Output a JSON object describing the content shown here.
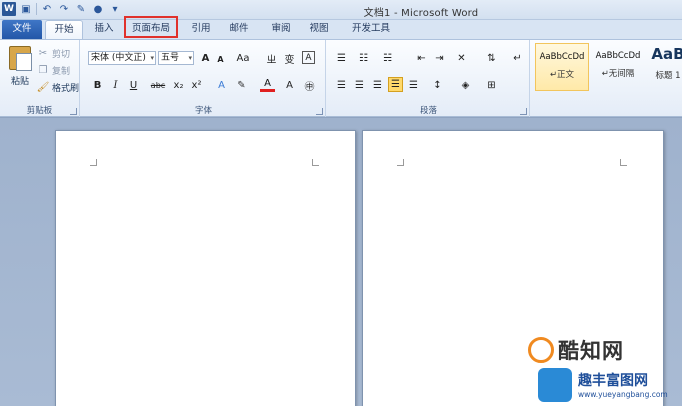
{
  "window": {
    "title": "文档1 - Microsoft Word"
  },
  "qat": {
    "word_logo": "W"
  },
  "tabs": [
    {
      "label": "文件"
    },
    {
      "label": "开始"
    },
    {
      "label": "插入"
    },
    {
      "label": "页面布局"
    },
    {
      "label": "引用"
    },
    {
      "label": "邮件"
    },
    {
      "label": "审阅"
    },
    {
      "label": "视图"
    },
    {
      "label": "开发工具"
    }
  ],
  "clipboard": {
    "paste": "粘贴",
    "cut": "剪切",
    "copy": "复制",
    "format_painter": "格式刷",
    "label": "剪贴板"
  },
  "font": {
    "name": "宋体 (中文正)",
    "size": "五号",
    "grow": "A",
    "shrink": "A",
    "change_case": "Aa",
    "bold": "B",
    "italic": "I",
    "underline": "U",
    "strike": "abc",
    "subscript": "x₂",
    "superscript": "x²",
    "font_color": "A",
    "label": "字体"
  },
  "paragraph": {
    "label": "段落"
  },
  "styles": {
    "items": [
      {
        "preview": "AaBbCcDd",
        "name": "↵正文"
      },
      {
        "preview": "AaBbCcDd",
        "name": "↵无间隔"
      },
      {
        "preview": "AaB",
        "name": "标题 1"
      }
    ]
  },
  "watermarks": {
    "brand1": "酷知网",
    "brand2": "趣丰富图网",
    "url": "www.yueyangbang.com"
  },
  "colors": {
    "accent": "#2b579a",
    "highlight_box": "#e0312c",
    "file_tab": "#2357a8"
  }
}
